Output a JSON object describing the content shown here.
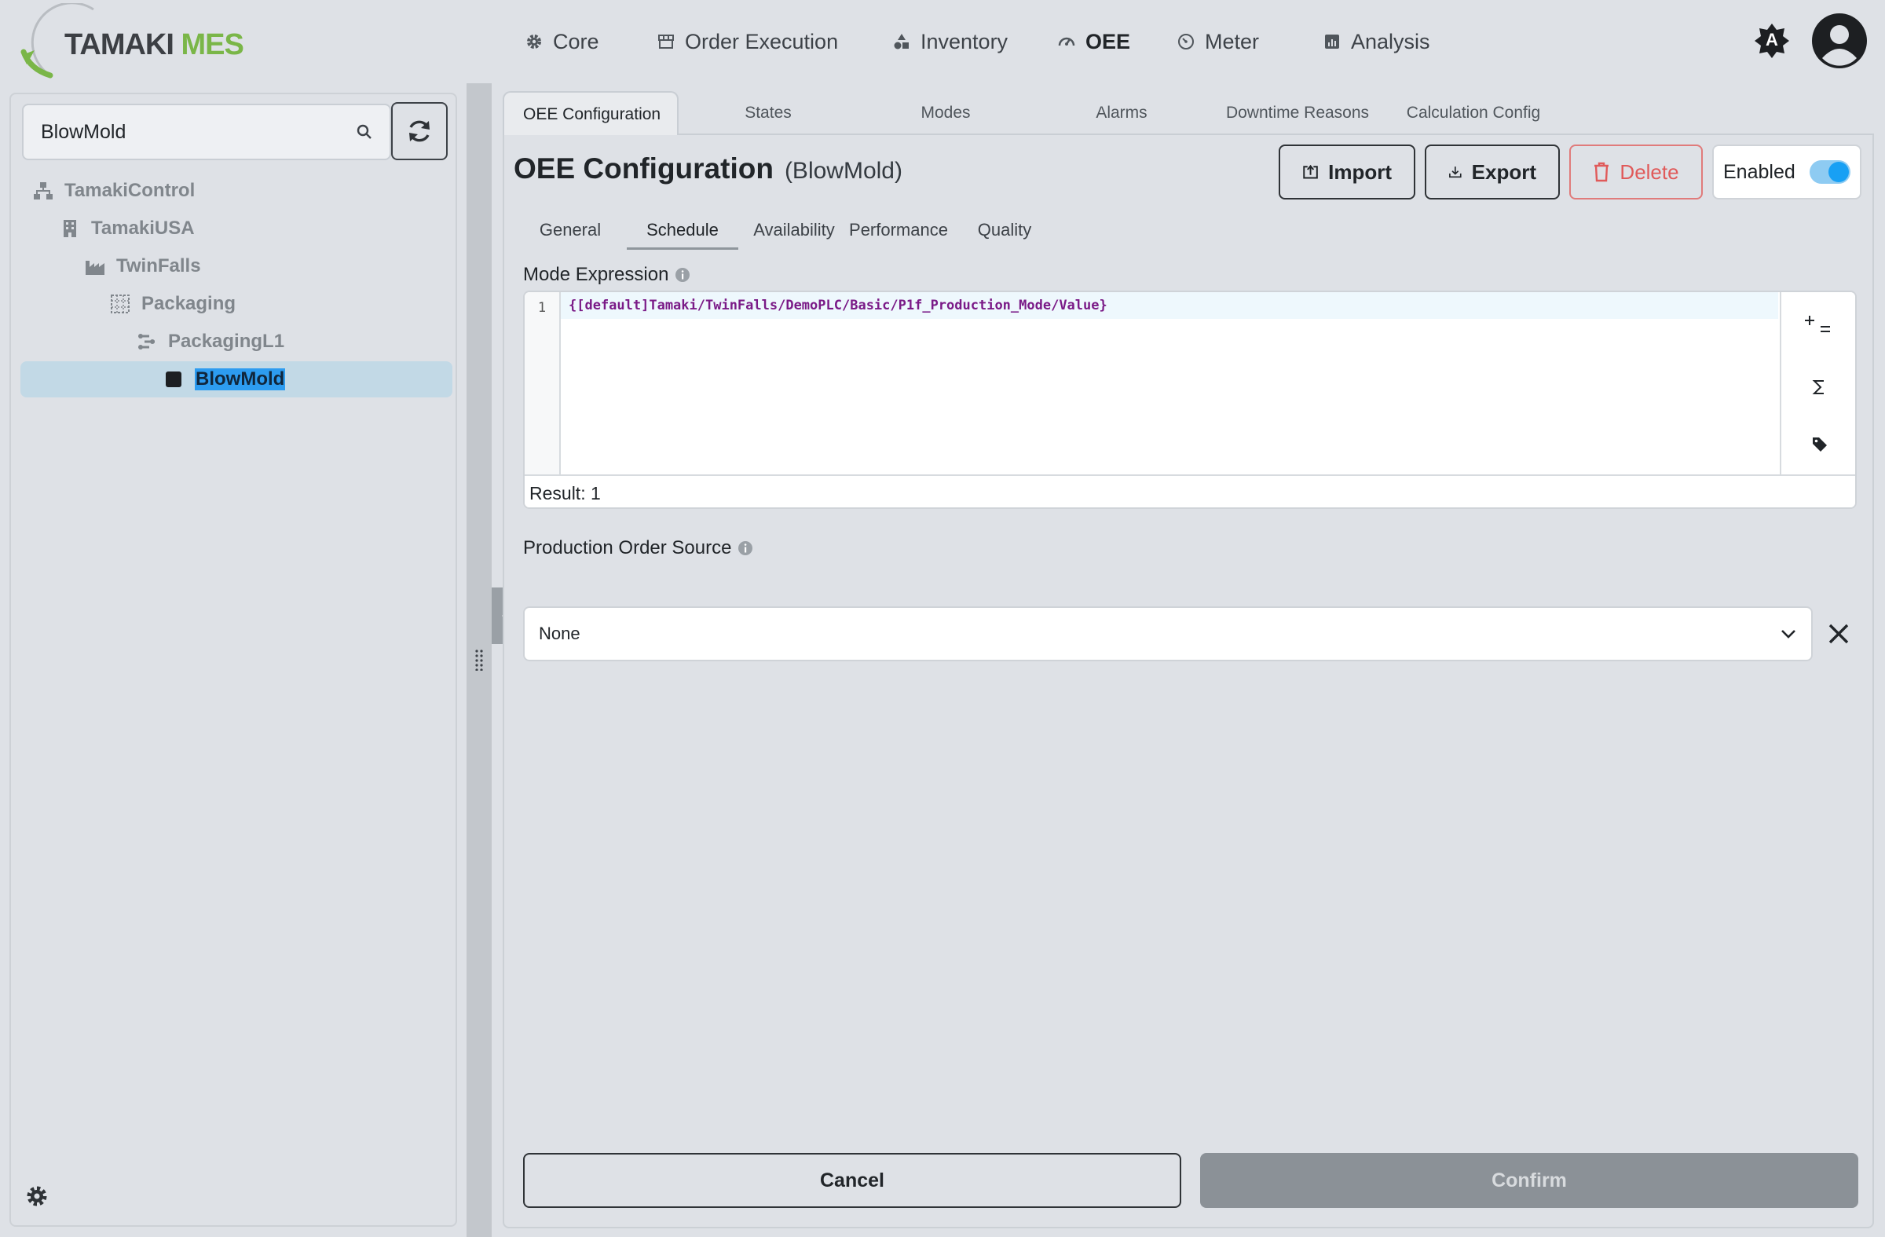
{
  "app": {
    "logo_main": "TAMAKI",
    "logo_accent": "MES"
  },
  "nav": {
    "items": [
      {
        "label": "Core",
        "icon": "gear-icon"
      },
      {
        "label": "Order Execution",
        "icon": "store-icon"
      },
      {
        "label": "Inventory",
        "icon": "shapes-icon"
      },
      {
        "label": "OEE",
        "icon": "gauge-icon",
        "active": true
      },
      {
        "label": "Meter",
        "icon": "meter-icon"
      },
      {
        "label": "Analysis",
        "icon": "chart-icon"
      }
    ]
  },
  "topright": {
    "theme_badge": "A",
    "account_icon": "user-circle-icon"
  },
  "sidebar": {
    "search": {
      "value": "BlowMold",
      "placeholder": ""
    },
    "tree": [
      {
        "label": "TamakiControl",
        "icon": "sitemap-icon"
      },
      {
        "label": "TamakiUSA",
        "icon": "building-icon"
      },
      {
        "label": "TwinFalls",
        "icon": "industry-icon"
      },
      {
        "label": "Packaging",
        "icon": "area-grid-icon"
      },
      {
        "label": "PackagingL1",
        "icon": "line-icon"
      },
      {
        "label": "BlowMold",
        "icon": "cell-square-icon",
        "selected": true
      }
    ]
  },
  "tabs": [
    "OEE Configuration",
    "States",
    "Modes",
    "Alarms",
    "Downtime Reasons",
    "Calculation Config"
  ],
  "header": {
    "title": "OEE Configuration",
    "subtitle": "(BlowMold)",
    "import_label": "Import",
    "export_label": "Export",
    "delete_label": "Delete",
    "enabled_label": "Enabled",
    "enabled": true
  },
  "subtabs": [
    "General",
    "Schedule",
    "Availability",
    "Performance",
    "Quality"
  ],
  "active_subtab": "Schedule",
  "mode_expression": {
    "label": "Mode Expression",
    "line_number": "1",
    "code": "{[default]Tamaki/TwinFalls/DemoPLC/Basic/P1f_Production_Mode/Value}",
    "tools": [
      "+=",
      "Σ",
      "tag"
    ],
    "result": "Result: 1"
  },
  "production_order_source": {
    "label": "Production Order Source",
    "value": "None"
  },
  "footer": {
    "cancel_label": "Cancel",
    "confirm_label": "Confirm"
  },
  "colors": {
    "accent_green": "#7ab648",
    "toggle_blue": "#18a0f4",
    "danger": "#e05a5a",
    "selected_bg": "#c2d9e6"
  }
}
